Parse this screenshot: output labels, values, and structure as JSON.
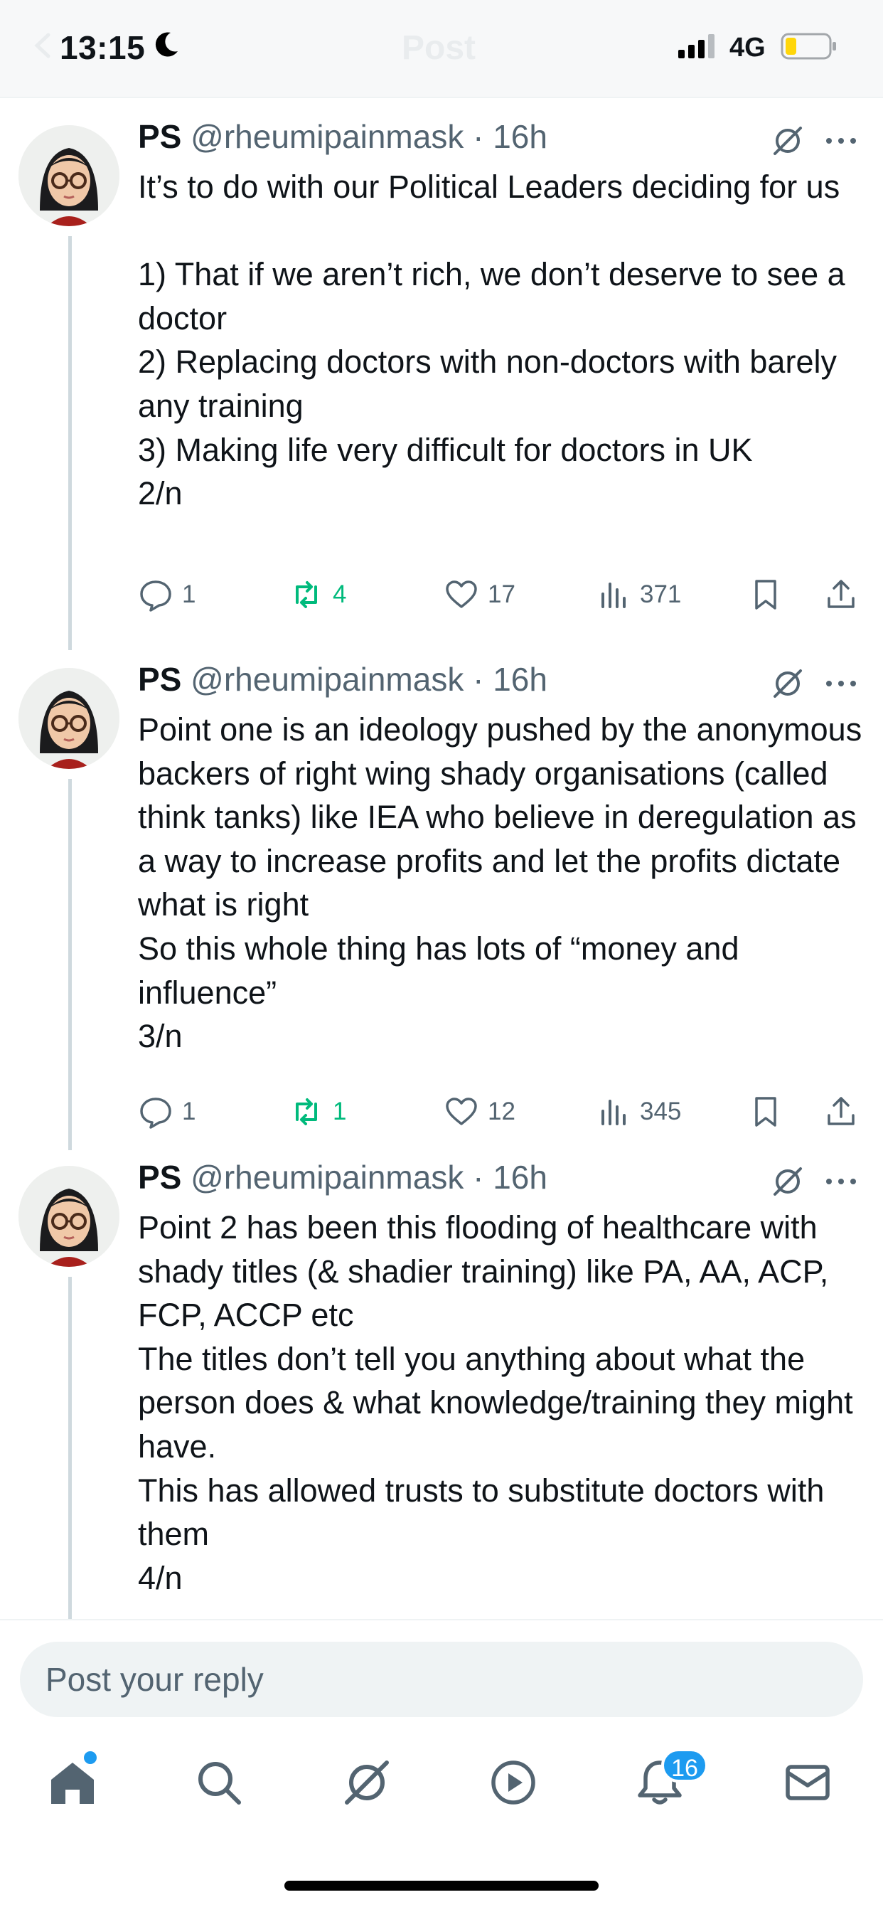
{
  "status_bar": {
    "time": "13:15",
    "network": "4G"
  },
  "header": {
    "title": "Post"
  },
  "tweets": [
    {
      "name": "PS",
      "handle": "@rheumipainmask",
      "time": "16h",
      "text": "It’s to do with our Political Leaders deciding for us\n\n1) That if we aren’t rich, we don’t deserve to see a doctor\n2) Replacing doctors with non-doctors with barely any training\n3) Making life very difficult for doctors in UK\n2/n",
      "replies": "1",
      "reposts": "4",
      "likes": "17",
      "views": "371"
    },
    {
      "name": "PS",
      "handle": "@rheumipainmask",
      "time": "16h",
      "text": "Point one is an ideology pushed by the anonymous backers of right wing shady organisations (called think tanks) like IEA who believe in deregulation as a way to increase profits and let the profits dictate what is right\nSo this whole thing has lots of “money and influence”\n3/n",
      "replies": "1",
      "reposts": "1",
      "likes": "12",
      "views": "345"
    },
    {
      "name": "PS",
      "handle": "@rheumipainmask",
      "time": "16h",
      "text": "Point 2 has been this flooding of healthcare with shady titles (& shadier training) like PA, AA, ACP, FCP, ACCP etc\nThe titles don’t tell you anything about what the person does & what knowledge/training they might have.\nThis has allowed trusts to substitute doctors with them\n4/n"
    }
  ],
  "reply_bar": {
    "placeholder": "Post your reply"
  },
  "nav": {
    "notifications_badge": "16"
  },
  "colors": {
    "accent": "#1d9bf0",
    "repost": "#00ba7c",
    "secondary_text": "#536471",
    "battery": "#ffd60a"
  }
}
